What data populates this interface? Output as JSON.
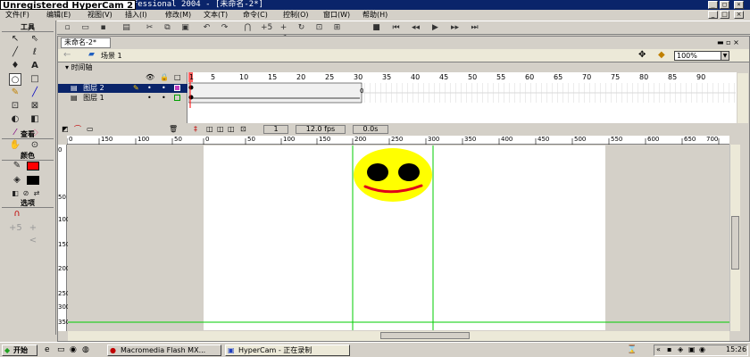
{
  "watermark": "Unregistered HyperCam 2",
  "window": {
    "title": "rofessional 2004 - [未命名-2*]"
  },
  "menu": [
    "文件(F)",
    "编辑(E)",
    "视图(V)",
    "插入(I)",
    "修改(M)",
    "文本(T)",
    "命令(C)",
    "控制(O)",
    "窗口(W)",
    "帮助(H)"
  ],
  "tools_panel": {
    "title": "工具",
    "view_title": "查看",
    "colors_title": "颜色",
    "options_title": "选项"
  },
  "document": {
    "tab": "未命名-2*",
    "scene": "场景 1",
    "zoom": "100%"
  },
  "timeline": {
    "header": "时间轴",
    "layers": [
      {
        "name": "图层 2"
      },
      {
        "name": "图层 1"
      }
    ],
    "frame_numbers": [
      "1",
      "5",
      "10",
      "15",
      "20",
      "25",
      "30",
      "35",
      "40",
      "45",
      "50",
      "55",
      "60",
      "65",
      "70",
      "75",
      "80",
      "85",
      "90"
    ],
    "current_frame": "1",
    "fps": "12.0 fps",
    "time": "0.0s",
    "end_frame_marker": "0"
  },
  "hruler_labels": [
    "0",
    "150",
    "100",
    "50",
    "0",
    "50",
    "100",
    "150",
    "200",
    "250",
    "300",
    "350",
    "400",
    "450",
    "500",
    "550",
    "600",
    "650",
    "700"
  ],
  "vruler_labels": [
    "0",
    "50",
    "100",
    "150",
    "200",
    "250",
    "300",
    "350"
  ],
  "taskbar": {
    "start": "开始",
    "tasks": [
      "Macromedia Flash MX...",
      "HyperCam - 正在录制"
    ],
    "clock": "15:26"
  },
  "colors": {
    "stroke": "#000000",
    "fill": "#ff0000",
    "face": "#ffff00",
    "eye": "#000000",
    "smile": "#e0001a",
    "guide": "#00cc00",
    "title": "#0a246a"
  }
}
